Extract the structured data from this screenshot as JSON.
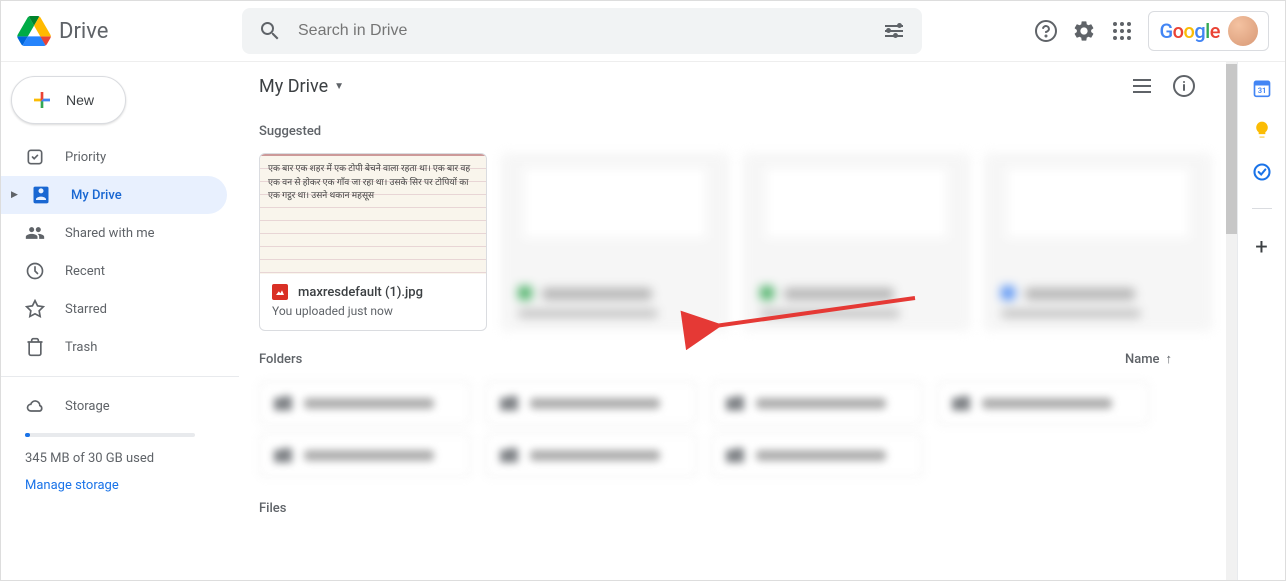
{
  "header": {
    "app_name": "Drive",
    "search_placeholder": "Search in Drive",
    "account_label": "Google"
  },
  "sidebar": {
    "new_label": "New",
    "items": [
      {
        "label": "Priority"
      },
      {
        "label": "My Drive"
      },
      {
        "label": "Shared with me"
      },
      {
        "label": "Recent"
      },
      {
        "label": "Starred"
      },
      {
        "label": "Trash"
      }
    ],
    "storage_label": "Storage",
    "storage_text": "345 MB of 30 GB used",
    "manage_label": "Manage storage"
  },
  "main": {
    "breadcrumb": "My Drive",
    "suggested_label": "Suggested",
    "suggested": [
      {
        "filename": "maxresdefault (1).jpg",
        "subtitle": "You uploaded just now",
        "thumb_text": "एक बार एक शहर में एक टोपी बेचने वाला रहता था। एक बार वह एक वन से होकर एक गाँव जा रहा था। उसके सिर पर टोपियों का एक गट्ठर था। उसने थकान महसूस"
      }
    ],
    "folders_label": "Folders",
    "sort_label": "Name",
    "files_label": "Files"
  }
}
